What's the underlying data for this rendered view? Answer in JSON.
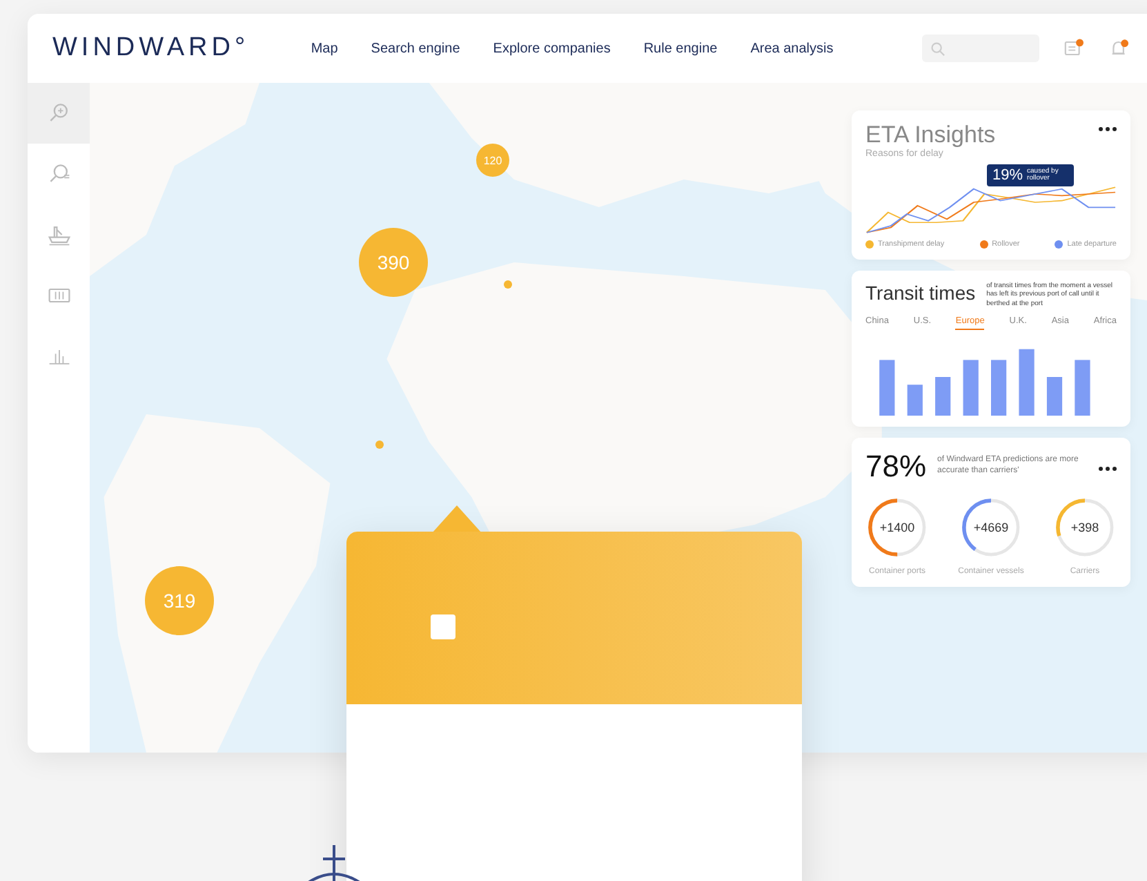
{
  "header": {
    "logo": "WINDWARD°",
    "nav": [
      {
        "label": "Map"
      },
      {
        "label": "Search engine"
      },
      {
        "label": "Explore companies"
      },
      {
        "label": "Rule engine"
      },
      {
        "label": "Area analysis"
      }
    ],
    "messages_unread": true,
    "alerts_unread": true
  },
  "sidebar": {
    "items": [
      {
        "kind": "search",
        "selected": true
      },
      {
        "kind": "search-list",
        "selected": false
      },
      {
        "kind": "ship",
        "selected": false
      },
      {
        "kind": "container",
        "selected": false
      },
      {
        "kind": "chart",
        "selected": false
      }
    ]
  },
  "map": {
    "clusters": [
      {
        "label": "120"
      },
      {
        "label": "390"
      },
      {
        "label": "319"
      }
    ]
  },
  "eta_card": {
    "title": "ETA Insights",
    "subtitle": "Reasons for delay",
    "tooltip": {
      "value": "19%",
      "text": "caused by rollover"
    },
    "legend": [
      {
        "label": "Transhipment delay",
        "color": "#f5b731"
      },
      {
        "label": "Rollover",
        "color": "#f07a1a"
      },
      {
        "label": "Late departure",
        "color": "#6e8ff0"
      }
    ]
  },
  "transit_card": {
    "title": "Transit times",
    "description": "of transit times from the moment a vessel has left its previous port of call until it berthed at the port",
    "tabs": [
      {
        "label": "China",
        "selected": false
      },
      {
        "label": "U.S.",
        "selected": false
      },
      {
        "label": "Europe",
        "selected": true
      },
      {
        "label": "U.K.",
        "selected": false
      },
      {
        "label": "Asia",
        "selected": false
      },
      {
        "label": "Africa",
        "selected": false
      }
    ]
  },
  "stats_card": {
    "percent": "78%",
    "text": "of Windward ETA predictions are more accurate than carriers'",
    "rings": [
      {
        "value": "+1400",
        "label": "Container ports",
        "color": "#f07a1a",
        "level": 0.5
      },
      {
        "value": "+4669",
        "label": "Container vessels",
        "color": "#6e8ff0",
        "level": 0.4
      },
      {
        "value": "+398",
        "label": "Carriers",
        "color": "#f5b731",
        "level": 0.3
      }
    ]
  }
}
